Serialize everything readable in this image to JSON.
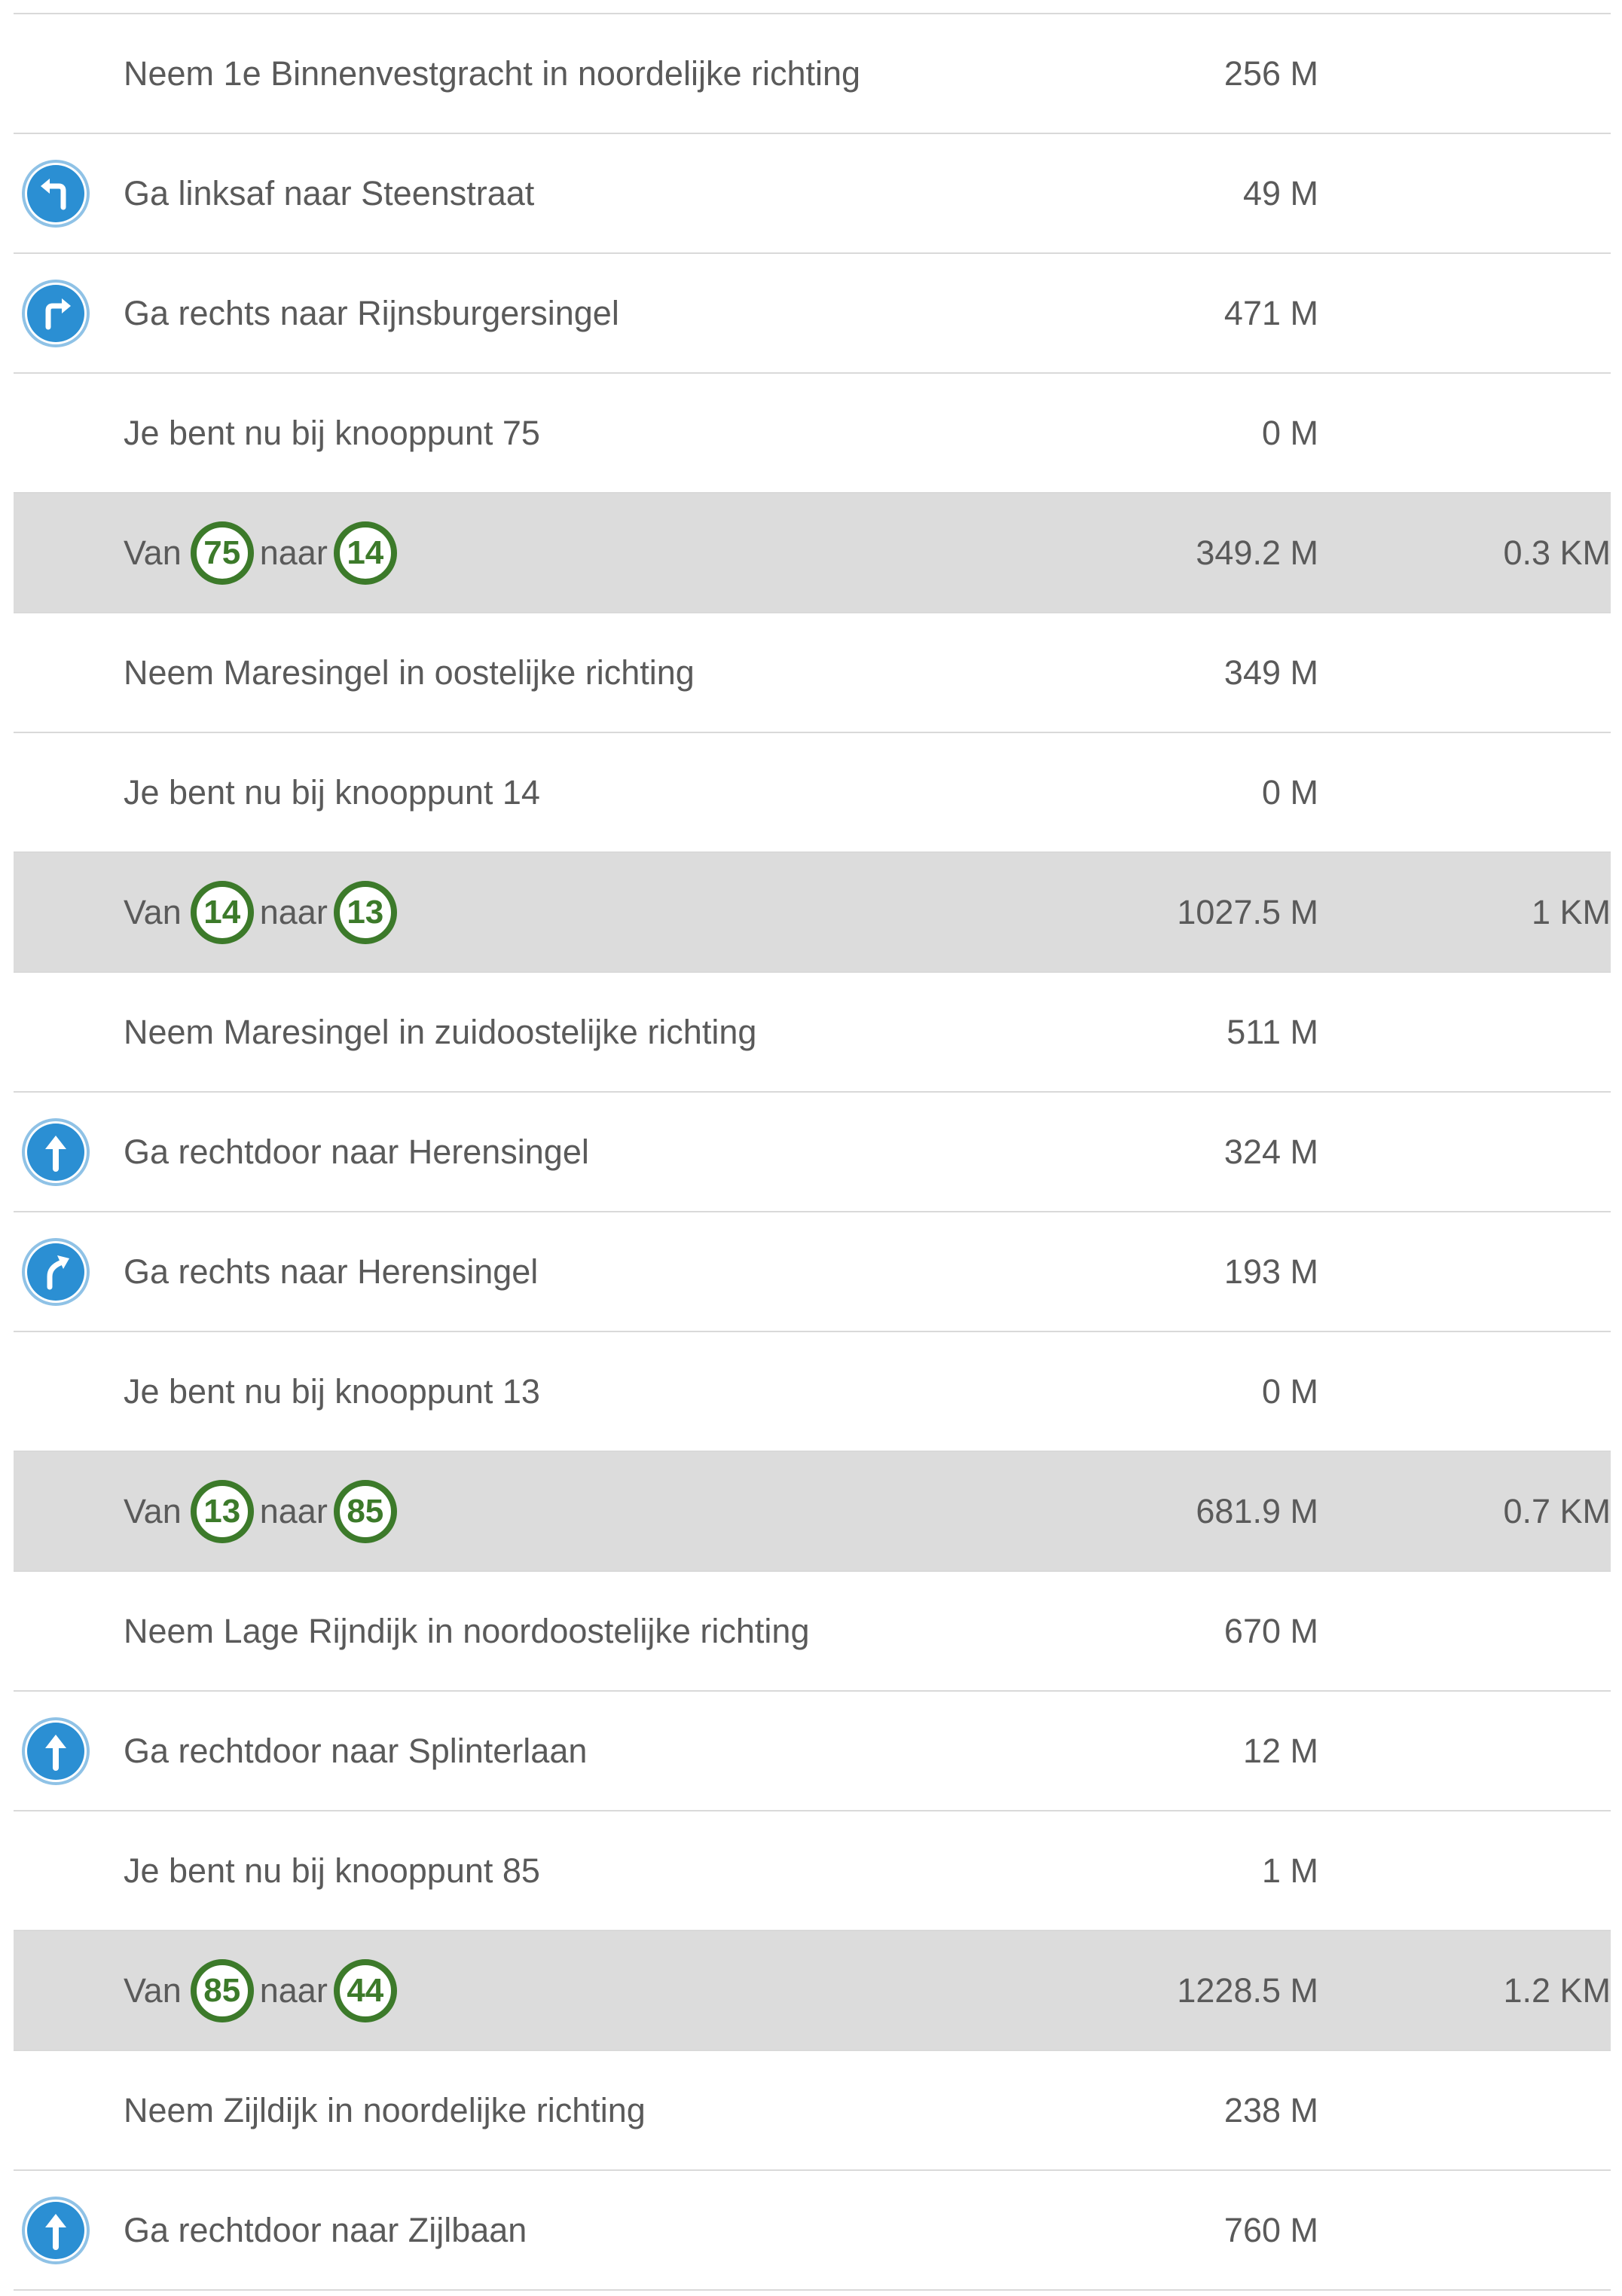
{
  "colors": {
    "node_ring": "#3c7a2a",
    "icon_fill": "#2b8fd3",
    "segment_bg": "#dcdcdc",
    "divider": "#d9d9d9",
    "text": "#5a5a5a"
  },
  "rows": [
    {
      "kind": "step",
      "icon": "",
      "text": "Neem 1e Binnenvestgracht in noordelijke richting",
      "dist": "256 M"
    },
    {
      "kind": "step",
      "icon": "turn-left-icon",
      "text": "Ga linksaf naar Steenstraat",
      "dist": "49 M"
    },
    {
      "kind": "step",
      "icon": "turn-right-icon",
      "text": "Ga rechts naar Rijnsburgersingel",
      "dist": "471 M"
    },
    {
      "kind": "step",
      "icon": "",
      "text": "Je bent nu bij knooppunt 75",
      "dist": "0 M"
    },
    {
      "kind": "segment",
      "van": "Van",
      "from": "75",
      "naar": "naar",
      "to": "14",
      "dist": "349.2 M",
      "km": "0.3 KM"
    },
    {
      "kind": "step",
      "icon": "",
      "text": "Neem Maresingel in oostelijke richting",
      "dist": "349 M"
    },
    {
      "kind": "step",
      "icon": "",
      "text": "Je bent nu bij knooppunt 14",
      "dist": "0 M"
    },
    {
      "kind": "segment",
      "van": "Van",
      "from": "14",
      "naar": "naar",
      "to": "13",
      "dist": "1027.5 M",
      "km": "1 KM"
    },
    {
      "kind": "step",
      "icon": "",
      "text": "Neem Maresingel in zuidoostelijke richting",
      "dist": "511 M"
    },
    {
      "kind": "step",
      "icon": "straight-arrow-icon",
      "text": "Ga rechtdoor naar Herensingel",
      "dist": "324 M"
    },
    {
      "kind": "step",
      "icon": "bear-right-icon",
      "text": "Ga rechts naar Herensingel",
      "dist": "193 M"
    },
    {
      "kind": "step",
      "icon": "",
      "text": "Je bent nu bij knooppunt 13",
      "dist": "0 M"
    },
    {
      "kind": "segment",
      "van": "Van",
      "from": "13",
      "naar": "naar",
      "to": "85",
      "dist": "681.9 M",
      "km": "0.7 KM"
    },
    {
      "kind": "step",
      "icon": "",
      "text": "Neem Lage Rijndijk in noordoostelijke richting",
      "dist": "670 M"
    },
    {
      "kind": "step",
      "icon": "straight-arrow-icon",
      "text": "Ga rechtdoor naar Splinterlaan",
      "dist": "12 M"
    },
    {
      "kind": "step",
      "icon": "",
      "text": "Je bent nu bij knooppunt 85",
      "dist": "1 M"
    },
    {
      "kind": "segment",
      "van": "Van",
      "from": "85",
      "naar": "naar",
      "to": "44",
      "dist": "1228.5 M",
      "km": "1.2 KM"
    },
    {
      "kind": "step",
      "icon": "",
      "text": "Neem Zijldijk in noordelijke richting",
      "dist": "238 M"
    },
    {
      "kind": "step",
      "icon": "straight-arrow-icon",
      "text": "Ga rechtdoor naar Zijlbaan",
      "dist": "760 M"
    }
  ]
}
